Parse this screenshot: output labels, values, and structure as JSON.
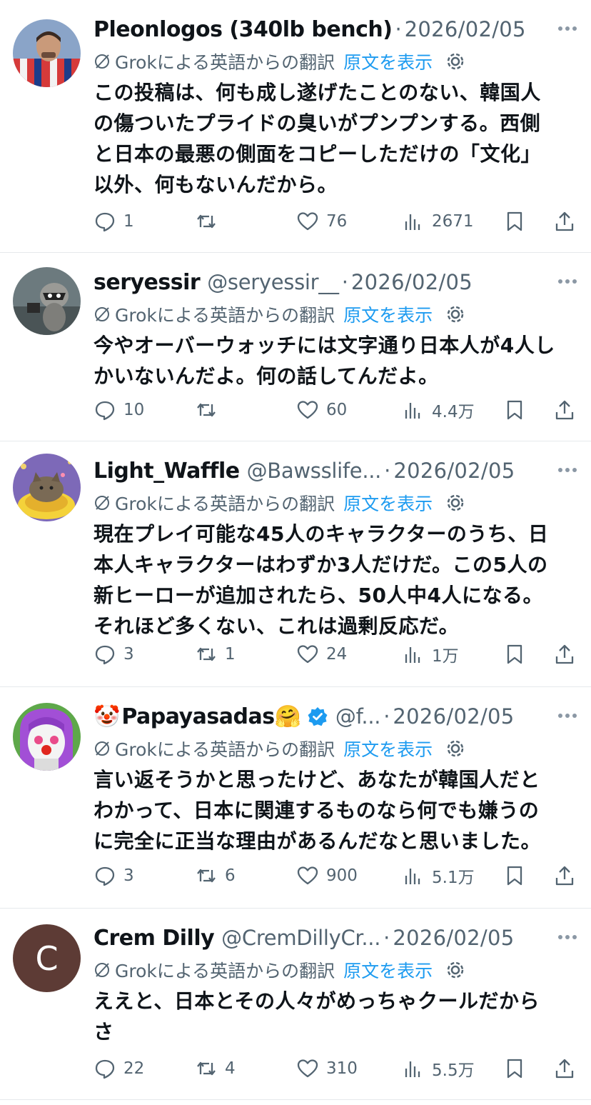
{
  "translation": {
    "label": "Grokによる英語からの翻訳",
    "show_original": "原文を表示"
  },
  "tweets": [
    {
      "name": "Pleonlogos (340lb bench)",
      "handle": "",
      "date": "2026/02/05",
      "text": [
        "この投稿は、何も成し遂げたことのない、韓国人",
        "の傷ついたプライドの臭いがプンプンする。西側",
        "と日本の最悪の側面をコピーしただけの「文化」",
        "以外、何もないんだから。"
      ],
      "replies": "1",
      "reposts": "",
      "likes": "76",
      "views": "2671",
      "avatar_icon": "user-photo-man-flag"
    },
    {
      "name": "seryessir",
      "handle": "@seryessir__",
      "date": "2026/02/05",
      "text": [
        "今やオーバーウォッチには文字通り日本人が4人し",
        "かいないんだよ。何の話してんだよ。"
      ],
      "replies": "10",
      "reposts": "",
      "likes": "60",
      "views": "4.4万",
      "avatar_icon": "user-photo-raccoon"
    },
    {
      "name": "Light_Waffle",
      "handle": "@Bawsslife...",
      "date": "2026/02/05",
      "text": [
        "現在プレイ可能な45人のキャラクターのうち、日",
        "本人キャラクターはわずか3人だけだ。この5人の",
        "新ヒーローが追加されたら、50人中4人になる。",
        "それほど多くない、これは過剰反応だ。"
      ],
      "replies": "3",
      "reposts": "1",
      "likes": "24",
      "views": "1万",
      "avatar_icon": "user-photo-cat"
    },
    {
      "name": "Papayasadas",
      "name_prefix_emoji": "🤡",
      "name_suffix_emoji": "🤗",
      "verified": true,
      "handle": "@f...",
      "date": "2026/02/05",
      "text": [
        "言い返そうかと思ったけど、あなたが韓国人だと",
        "わかって、日本に関連するものなら何でも嫌うの",
        "に完全に正当な理由があるんだなと思いました。"
      ],
      "replies": "3",
      "reposts": "6",
      "likes": "900",
      "views": "5.1万",
      "avatar_icon": "user-photo-clown-drawing"
    },
    {
      "name": "Crem Dilly",
      "handle": "@CremDillyCr...",
      "date": "2026/02/05",
      "text": [
        "ええと、日本とその人々がめっちゃクールだから",
        "さ"
      ],
      "replies": "22",
      "reposts": "4",
      "likes": "310",
      "views": "5.5万",
      "avatar_icon": "letter-avatar",
      "avatar_letter": "C"
    }
  ],
  "colors": {
    "accent": "#1d9bf0",
    "muted": "#536471",
    "text": "#0f1419",
    "divider": "#e6e9ec",
    "avatar_c": "#5d3b35"
  },
  "icons": [
    "reply-icon",
    "repost-icon",
    "like-icon",
    "views-icon",
    "bookmark-icon",
    "share-icon",
    "more-icon",
    "gear-icon",
    "grok-icon",
    "verified-icon"
  ]
}
